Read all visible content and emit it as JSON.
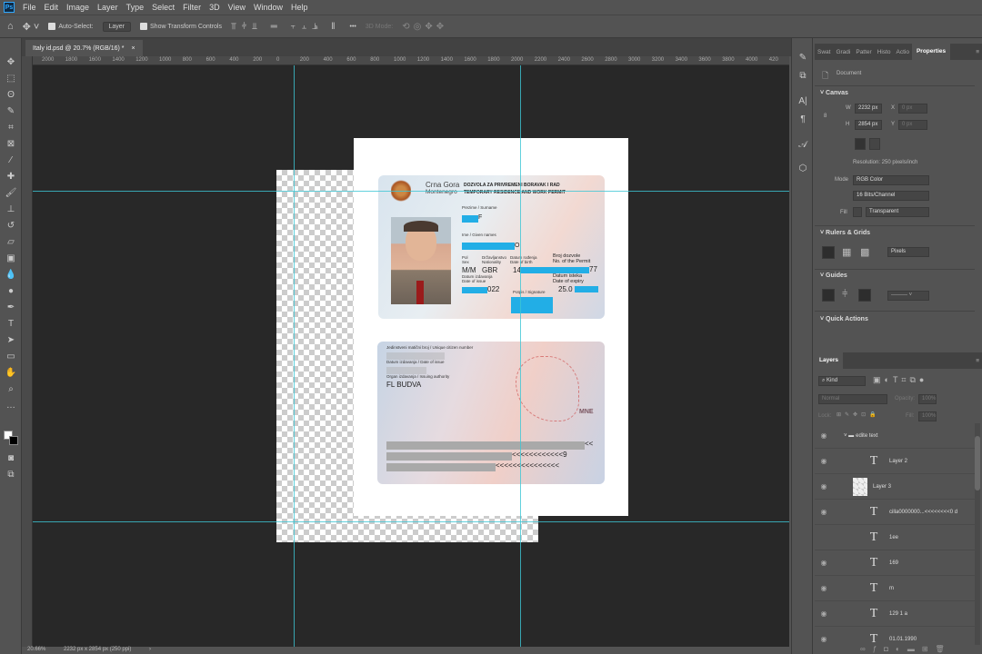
{
  "app": {
    "logo": "Ps",
    "menu": [
      "File",
      "Edit",
      "Image",
      "Layer",
      "Type",
      "Select",
      "Filter",
      "3D",
      "View",
      "Window",
      "Help"
    ]
  },
  "options": {
    "auto_select_label": "Auto-Select:",
    "auto_select_value": "Layer",
    "show_transform_label": "Show Transform Controls",
    "more": "•••",
    "mode_3d": "3D Mode:"
  },
  "document": {
    "tab_title": "Italy id.psd @ 20.7% (RGB/16) *",
    "close": "×"
  },
  "ruler": {
    "top_ticks": [
      "2000",
      "1800",
      "1600",
      "1400",
      "1200",
      "1000",
      "800",
      "600",
      "400",
      "200",
      "0",
      "200",
      "400",
      "600",
      "800",
      "1000",
      "1200",
      "1400",
      "1600",
      "1800",
      "2000",
      "2200",
      "2400",
      "2600",
      "2800",
      "3000",
      "3200",
      "3400",
      "3600",
      "3800",
      "4000",
      "420"
    ]
  },
  "card_front": {
    "country": "Crna Gora",
    "country_en": "Montenegro",
    "title1": "DOZVOLA ZA PRIVREMENI BORAVAK I RAD",
    "title2": "TEMPORARY RESIDENCE AND WORK PERMIT",
    "surname_label": "Prezime / Surname",
    "surname_tail": "F",
    "name_label": "Ime / Given names",
    "name_tail": "O",
    "sex_label": "Pol\nSex",
    "nat_label": "Državljanstvo\nNationality",
    "dob_label": "Datum rođenja\nDate of birth",
    "permit_label": "Broj dozvole\nNo. of the Permit",
    "sex": "M/M",
    "nationality": "GBR",
    "dob_head": "14",
    "permit_tail": "77",
    "issue_label": "Datum izdavanja\nDate of issue",
    "issue_tail": "022",
    "signature_label": "Potpis / Signature",
    "expiry_label": "Datum isteka\nDate of expiry",
    "expiry_head": "25.0"
  },
  "card_back": {
    "id_label": "Jedinstveni matični broj / Unique citizen number",
    "doi_label": "Datum izdavanja / Date of issue",
    "authority_label": "Organ izdavanja / Issuing authority",
    "authority": "FL BUDVA",
    "code": "MNE",
    "mrz1": "<<",
    "mrz2": "<<<<<<<<<<<<9",
    "mrz3": "<<<<<<<<<<<<<<<"
  },
  "status": {
    "zoom": "20.66%",
    "info": "2232 px x 2854 px (250 ppi)",
    "arrow": "›"
  },
  "properties": {
    "tabs": [
      "Swat",
      "Gradi",
      "Patter",
      "Histo",
      "Actio",
      "Properties"
    ],
    "doc_label": "Document",
    "canvas": "Canvas",
    "w_label": "W",
    "w": "2232 px",
    "h_label": "H",
    "h": "2854 px",
    "x_label": "X",
    "x": "0 px",
    "y_label": "Y",
    "y": "0 px",
    "resolution": "Resolution: 250 pixels/inch",
    "mode_label": "Mode",
    "mode": "RGB Color",
    "depth": "16 Bits/Channel",
    "fill_label": "Fill",
    "fill": "Transparent",
    "rulers": "Rulers & Grids",
    "units": "Pixels",
    "guides": "Guides",
    "quick": "Quick Actions"
  },
  "layers": {
    "title": "Layers",
    "filter": "Kind",
    "blend": "Normal",
    "opacity_label": "Opacity:",
    "opacity": "100%",
    "lock_label": "Lock:",
    "fill_label": "Fill:",
    "fill": "100%",
    "items": [
      {
        "name": "edite text",
        "type": "group",
        "visible": true
      },
      {
        "name": "Layer 2",
        "type": "text",
        "visible": true
      },
      {
        "name": "Layer 3",
        "type": "image",
        "visible": true
      },
      {
        "name": "cilla0000000...<<<<<<<<0 d",
        "type": "text",
        "visible": true
      },
      {
        "name": "1ee",
        "type": "text",
        "visible": false
      },
      {
        "name": "169",
        "type": "text",
        "visible": true
      },
      {
        "name": "m",
        "type": "text",
        "visible": true
      },
      {
        "name": "129 1 a",
        "type": "text",
        "visible": true
      },
      {
        "name": "01.01.1990",
        "type": "text",
        "visible": true
      }
    ]
  }
}
